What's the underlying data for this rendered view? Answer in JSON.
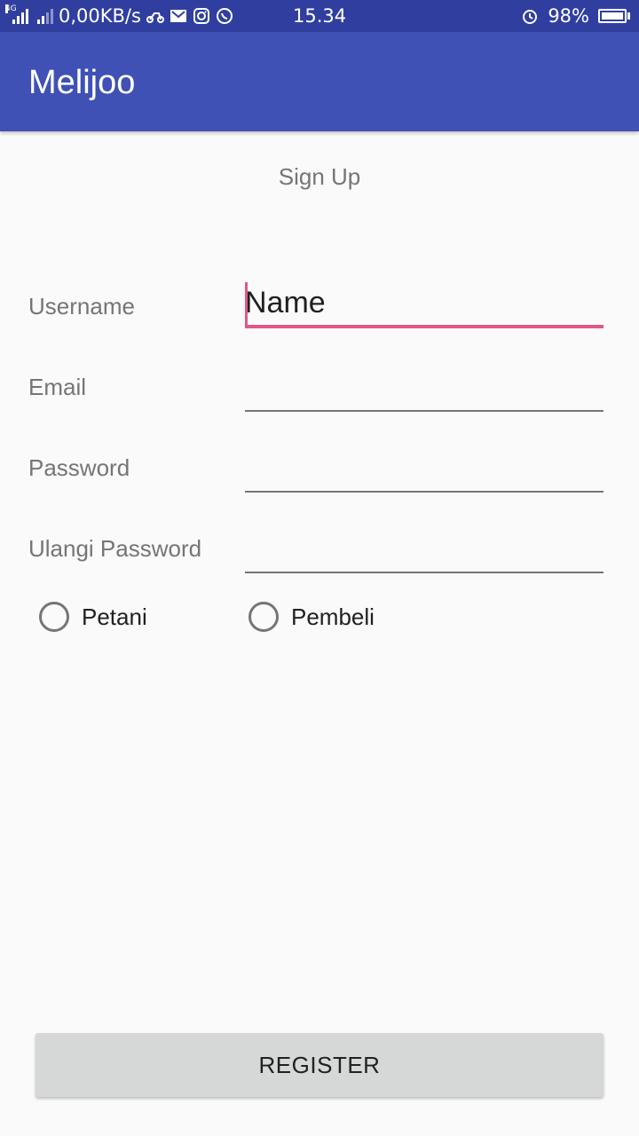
{
  "status_bar": {
    "network_type": "4G",
    "data_speed": "0,00KB/s",
    "time": "15.34",
    "battery_percent": "98%",
    "battery_level": 0.98,
    "icons": [
      "signal-icon",
      "signal-alt-icon",
      "bike-icon",
      "gmail-icon",
      "instagram-icon",
      "whatsapp-icon",
      "alarm-icon",
      "battery-icon"
    ]
  },
  "app_bar": {
    "title": "Melijoo",
    "color": "#3f51b5"
  },
  "form": {
    "title": "Sign Up",
    "fields": [
      {
        "label": "Username",
        "value": "Name",
        "focused": true
      },
      {
        "label": "Email",
        "value": ""
      },
      {
        "label": "Password",
        "value": ""
      },
      {
        "label": "Ulangi Password",
        "value": ""
      }
    ],
    "roles": [
      {
        "label": "Petani",
        "selected": false
      },
      {
        "label": "Pembeli",
        "selected": false
      }
    ],
    "accent_color": "#e0578a"
  },
  "register_button": {
    "label": "REGISTER"
  }
}
